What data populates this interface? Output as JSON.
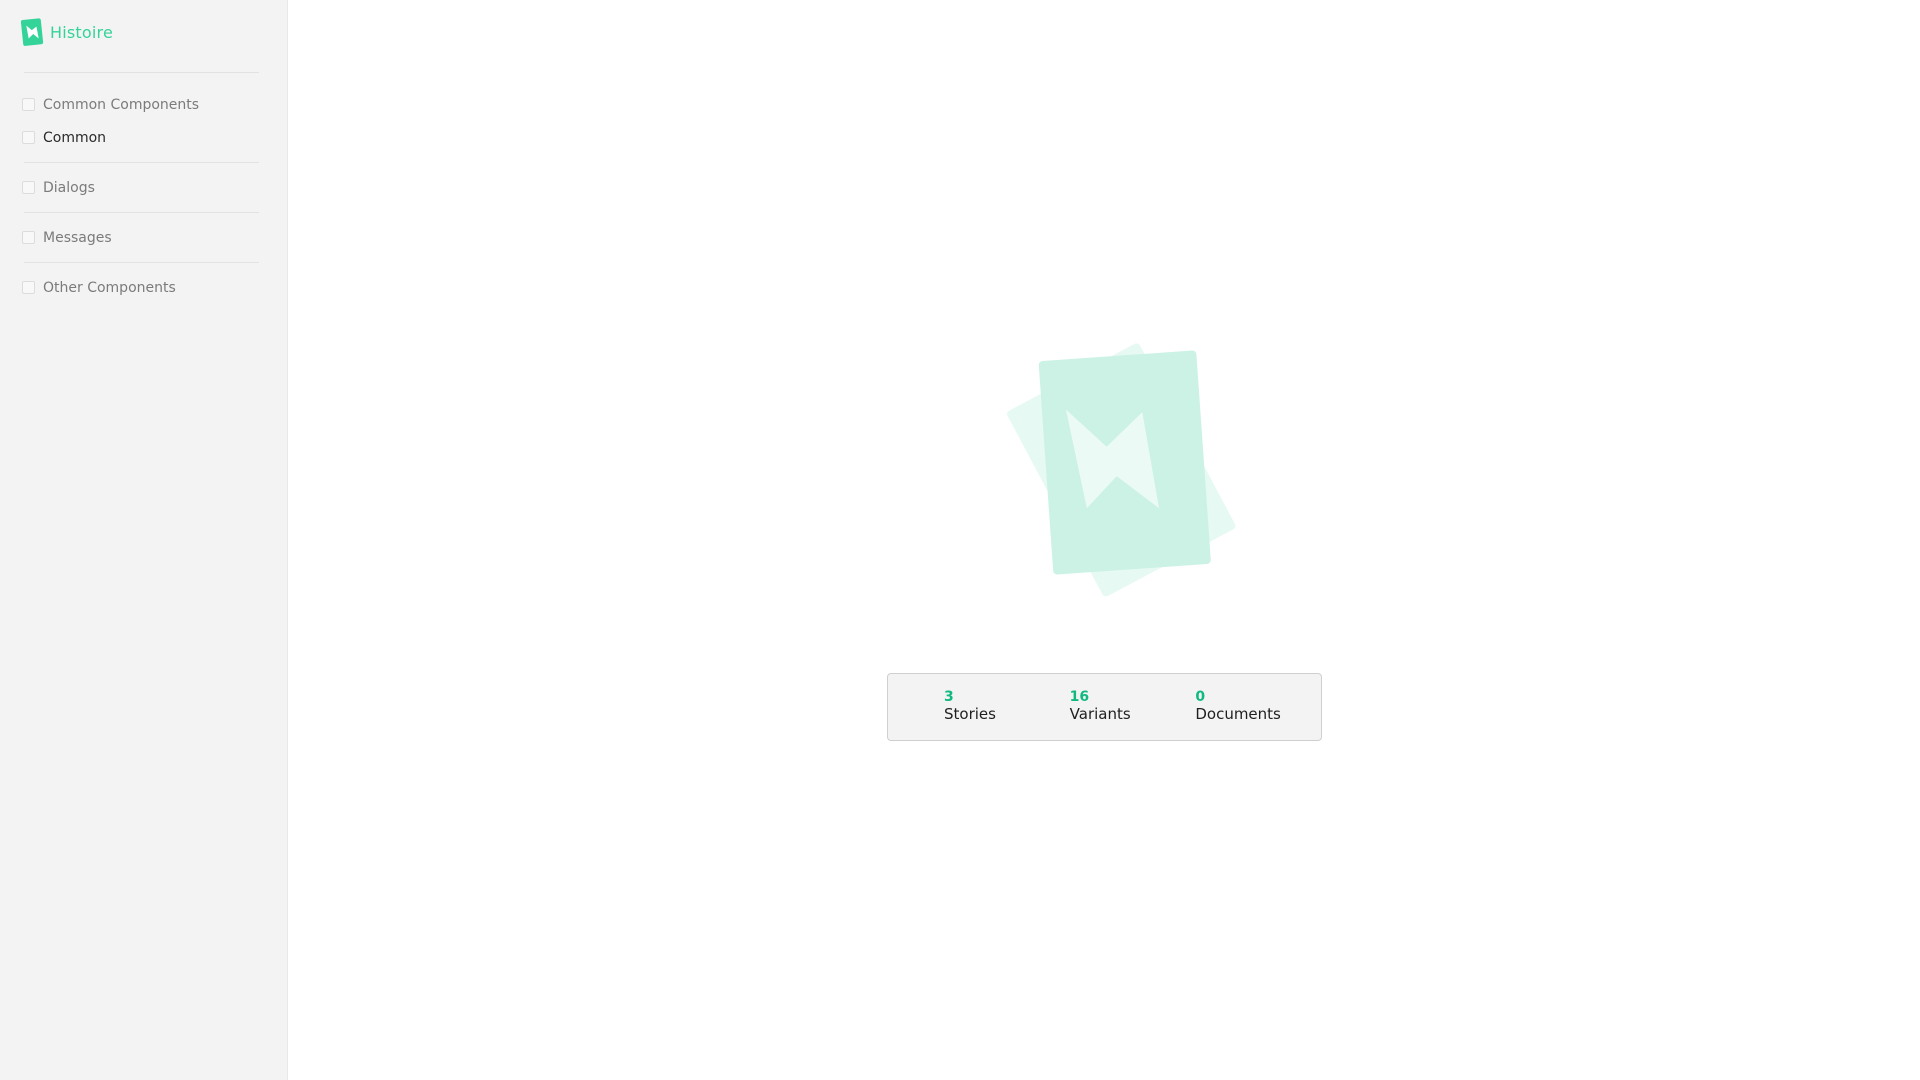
{
  "app": {
    "title": "Histoire",
    "brand_color": "#34d399",
    "logo_icon": "histoire-logo-icon"
  },
  "sidebar": {
    "items": [
      {
        "label": "Common Components",
        "active": false
      },
      {
        "label": "Common",
        "active": true
      },
      {
        "label": "Dialogs",
        "active": false
      },
      {
        "label": "Messages",
        "active": false
      },
      {
        "label": "Other Components",
        "active": false
      }
    ]
  },
  "stats": {
    "stories": {
      "value": "3",
      "label": "Stories"
    },
    "variants": {
      "value": "16",
      "label": "Variants"
    },
    "documents": {
      "value": "0",
      "label": "Documents"
    }
  },
  "colors": {
    "accent": "#10b981",
    "logo_light": "#ccf2e5",
    "logo_lighter": "#e6f9f2"
  }
}
